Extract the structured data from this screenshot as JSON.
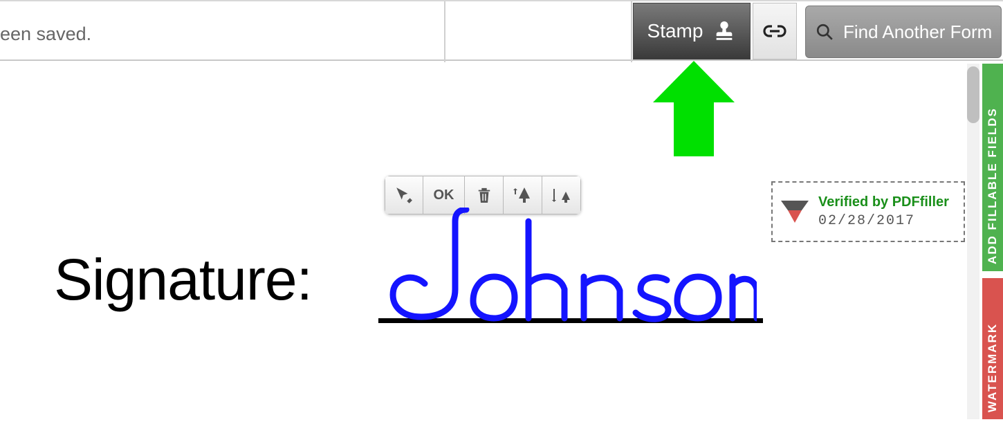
{
  "toolbar": {
    "status_text": "een saved.",
    "stamp_label": "Stamp",
    "search_placeholder": "Find Another Form"
  },
  "mini_toolbar": {
    "ok_label": "OK"
  },
  "document": {
    "signature_label": "Signature:",
    "signature_value": "Johnson"
  },
  "verify_stamp": {
    "verified_text": "Verified by PDFfiller",
    "date": "02/28/2017"
  },
  "side_tabs": {
    "add_fields": "ADD FILLABLE FIELDS",
    "watermark": "WATERMARK"
  }
}
